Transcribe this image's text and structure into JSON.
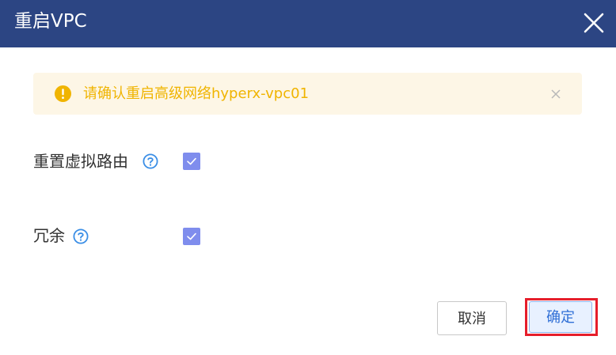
{
  "dialog": {
    "title": "重启VPC",
    "close_icon": "close-icon"
  },
  "alert": {
    "icon": "warning-icon",
    "message": "请确认重启高级网络hyperx-vpc01",
    "close_icon": "close-icon",
    "background_color": "#fdf6e6",
    "text_color": "#f0b400"
  },
  "options": [
    {
      "label": "重置虚拟路由",
      "help_icon": "help-icon",
      "checked": true
    },
    {
      "label": "冗余",
      "help_icon": "help-icon",
      "checked": true
    }
  ],
  "footer": {
    "cancel_label": "取消",
    "confirm_label": "确定"
  },
  "colors": {
    "header": "#2c4583",
    "checkbox": "#7f8ded",
    "highlight": "#e61e2b",
    "primary_text": "#2f6fd6"
  }
}
